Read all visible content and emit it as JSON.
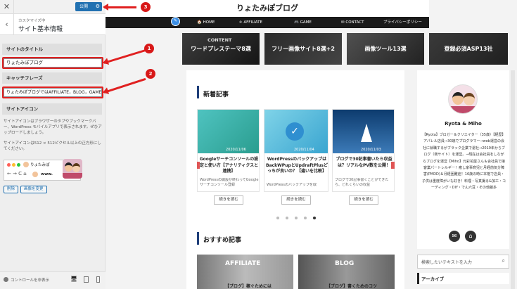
{
  "customizer": {
    "close_icon": "✕",
    "publish_label": "公開",
    "back_icon": "‹",
    "breadcrumb": "カスタマイズ中",
    "title": "サイト基本情報",
    "site_title_section": "サイトのタイトル",
    "site_title_value": "りょたみぽブログ",
    "tagline_section": "キャッチフレーズ",
    "tagline_value": "りょたみぽブログではAFFILIATE，BLOG，GAME",
    "icon_section": "サイトアイコン",
    "icon_desc1": "サイトアイコンはブラウザーのタブやブックマークバー、WordPress モバイルアプリで表示されます。ぜひアップロードしましょう。",
    "icon_desc2": "サイトアイコンは512 × 512ピクセル以上の正方形にしてください。",
    "tab_preview_text": "りょたみぽ",
    "url_preview_text": "www.",
    "remove_label": "削除",
    "change_label": "画像を変更",
    "hide_controls_label": "コントロールを非表示"
  },
  "annotations": {
    "n1": "1",
    "n2": "2",
    "n3": "3"
  },
  "site": {
    "title": "りょたみぽブログ",
    "nav": [
      {
        "icon": "🏠",
        "label": "HOME"
      },
      {
        "icon": "✈",
        "label": "AFFILIATE"
      },
      {
        "icon": "🎮",
        "label": "GAME"
      },
      {
        "icon": "✉",
        "label": "CONTACT"
      },
      {
        "icon": "",
        "label": "プライバシーポリシー"
      }
    ],
    "banners": [
      "ワードプレステーマ8選",
      "フリー画像サイト8選+2",
      "画像ツール13選",
      "登録必須ASP13社"
    ],
    "banner_sub": "CONTENT",
    "new_heading": "新着記事",
    "cards": [
      {
        "date": "2020/11/06",
        "title": "Googleサーチコンソールの設定と使い方【アナリティクスと連携】",
        "excerpt": "WordPressの開設が終わってGoogleサーチコンソール登録"
      },
      {
        "date": "2020/11/04",
        "title": "WordPressのバックアップはBackWPupとUpdraftPlusどっちが良いの？【違いを比較】",
        "excerpt": "WordPressのバックアップを取"
      },
      {
        "date": "2020/11/03",
        "title": "ブログで30記事書いたら収益は？リアルなPV数を公開！",
        "excerpt": "ブログで30記事書くことができたら、どれくらいの収益"
      }
    ],
    "read_more": "続きを読む",
    "recommend_heading": "おすすめ記事",
    "rec_cards": [
      {
        "label": "AFFILIATE",
        "title": "【ブログ】稼ぐためには"
      },
      {
        "label": "BLOG",
        "title": "【ブログ】書くためのコツ"
      }
    ],
    "profile_name": "Ryota & Miho",
    "profile_text": "【Ryota】ブロガー＆クリエイター（35歳）【経歴】アパレル店員→30歳でプログラマー→web運営の会社に就職するがブラック企業で退社→2019年からブログ（我サイト）を運営。→現在は会社員をしながらブログを運営【Miho】元彩花屋さん＆会社員で接客業パートレルギー！癒し家事育児と月経前気分障害(PMDD)＆月経困難症！16歳の時に本格で店員・子供は重度障がいも好き！料理・写真撮る&加工・コーディング・DIY・でん六豆・その他雑多",
    "search_placeholder": "検索したいテキストを入力",
    "archive_heading": "アーカイブ"
  },
  "colors": {
    "wp_blue": "#2271b1",
    "annotation_red": "#e02020",
    "nav_bg": "#1a1a1a"
  }
}
